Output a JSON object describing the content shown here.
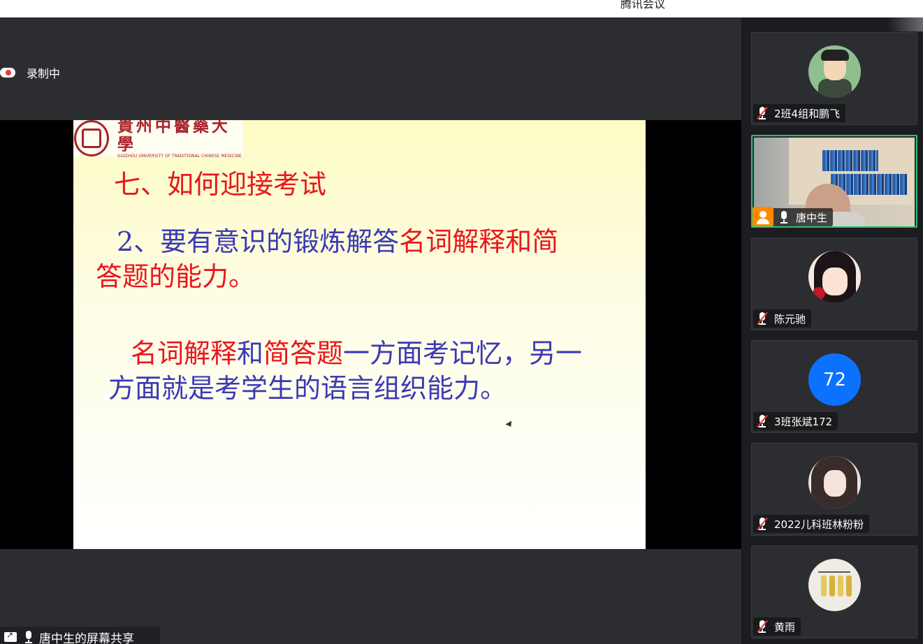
{
  "window": {
    "title": "腾讯会议"
  },
  "recording": {
    "label": "录制中"
  },
  "slide": {
    "logo_cn": "貴州中醫藥大學",
    "logo_en": "GUIZHOU UNIVERSITY OF TRADITIONAL CHINESE MEDICINE",
    "heading": "七、如何迎接考试",
    "p1_line1_blue": "2、要有意识的锻炼解答",
    "p1_line1_red": "名词解释和简",
    "p1_line2_red": "答题的能力。",
    "p2_line1_red1": "名词解释",
    "p2_line1_blue1": "和",
    "p2_line1_red2": "简答题",
    "p2_line1_blue2": "一方面考记忆，另一",
    "p2_line2_blue": "方面就是考学生的语言组织能力。"
  },
  "share_bar": {
    "label": "唐中生的屏幕共享"
  },
  "participants": [
    {
      "name": "2班4组和鹏飞",
      "muted": true,
      "avatar": "cartoon-teacher-avatar"
    },
    {
      "name": "唐中生",
      "muted": false,
      "host": true,
      "video": true
    },
    {
      "name": "陈元驰",
      "muted": true,
      "avatar": "anime-girl-avatar"
    },
    {
      "name": "3班张斌172",
      "muted": true,
      "avatar_text": "72"
    },
    {
      "name": "2022儿科班林粉粉",
      "muted": true,
      "avatar": "anime-longhair-avatar"
    },
    {
      "name": "黄雨",
      "muted": true,
      "avatar": "sketch-figures-avatar"
    }
  ],
  "colors": {
    "accent_green": "#2fbf71",
    "number_avatar": "#0a72ff",
    "host_orange": "#ff8a00",
    "slide_red": "#e8171c",
    "slide_blue": "#3b39b4"
  }
}
